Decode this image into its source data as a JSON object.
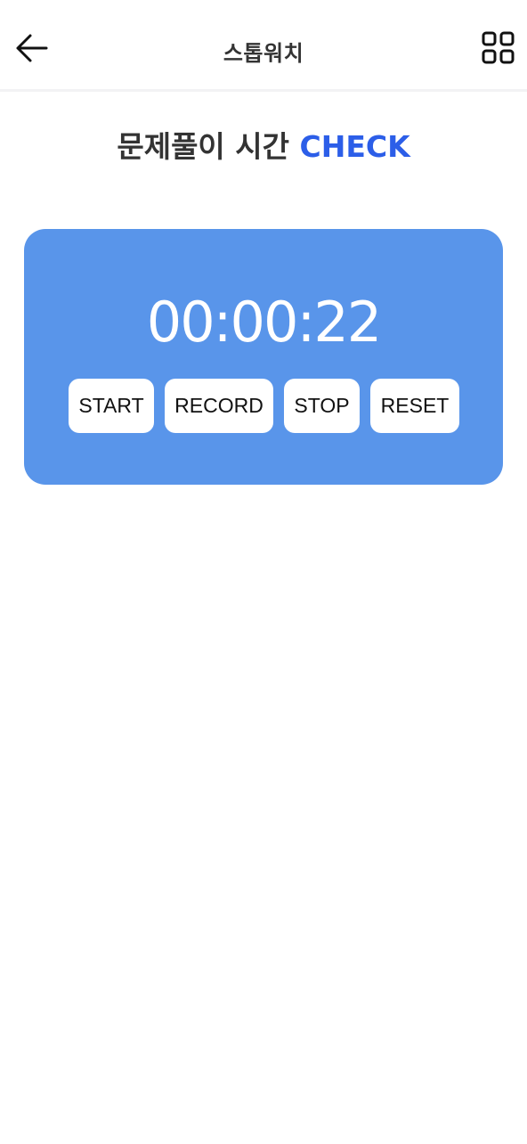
{
  "header": {
    "back_icon": "arrow-left-icon",
    "title": "스톱워치",
    "menu_icon": "grid-four-squares-icon"
  },
  "headline": {
    "text": "문제풀이 시간 ",
    "accent": "CHECK",
    "accent_color": "#2c5ee8"
  },
  "timer": {
    "display": "00:00:22",
    "card_color": "#5995ea"
  },
  "controls": {
    "start_label": "START",
    "record_label": "RECORD",
    "stop_label": "STOP",
    "reset_label": "RESET"
  }
}
